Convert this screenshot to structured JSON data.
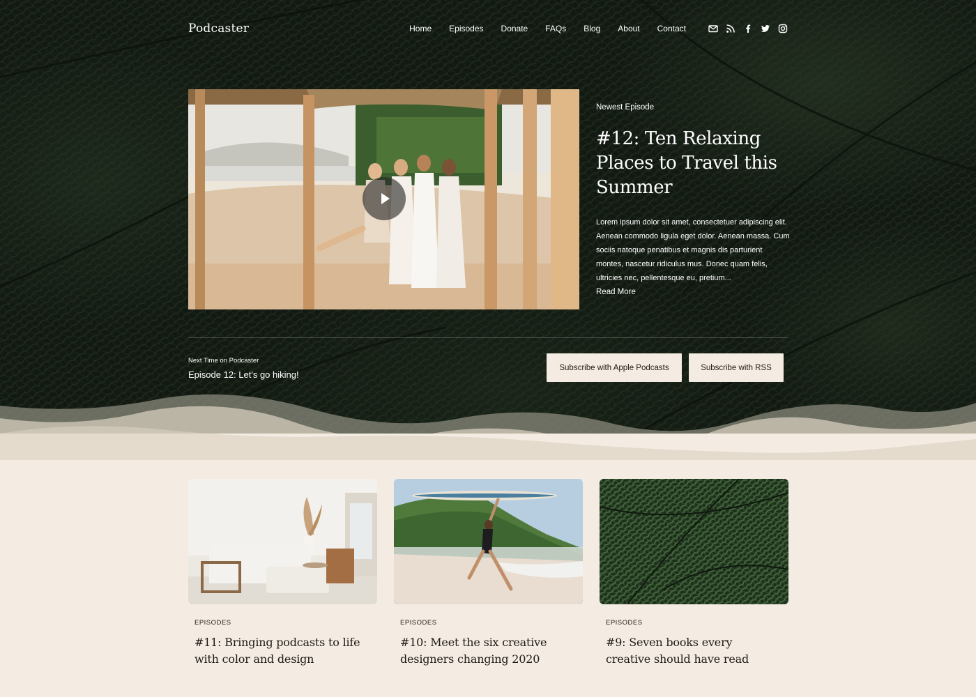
{
  "site": {
    "logo": "Podcaster"
  },
  "nav": {
    "links": [
      "Home",
      "Episodes",
      "Donate",
      "FAQs",
      "Blog",
      "About",
      "Contact"
    ],
    "social": [
      "mail-icon",
      "rss-icon",
      "facebook-icon",
      "twitter-icon",
      "instagram-icon"
    ]
  },
  "featured": {
    "eyebrow": "Newest Episode",
    "title": "#12: Ten Relaxing Places to Travel this Summer",
    "excerpt": "Lorem ipsum dolor sit amet, consectetuer adipiscing elit. Aenean commodo ligula eget dolor. Aenean massa. Cum sociis natoque penatibus et magnis dis parturient montes, nascetur ridiculus mus. Donec quam felis, ultricies nec, pellentesque eu, pretium...",
    "read_more": "Read More",
    "media_icon": "play-icon"
  },
  "next": {
    "label": "Next Time on Podcaster",
    "episode": "Episode 12: Let's go hiking!"
  },
  "subscribe": {
    "apple": "Subscribe with Apple Podcasts",
    "rss": "Subscribe with RSS"
  },
  "cards": [
    {
      "category": "EPISODES",
      "title": "#11: Bringing podcasts to life with color and design"
    },
    {
      "category": "EPISODES",
      "title": "#10: Meet the six creative designers changing 2020"
    },
    {
      "category": "EPISODES",
      "title": "#9: Seven books every creative should have read"
    }
  ],
  "colors": {
    "hero_bg": "#182018",
    "cream": "#f4ece2",
    "text_dark": "#1f1a17"
  }
}
